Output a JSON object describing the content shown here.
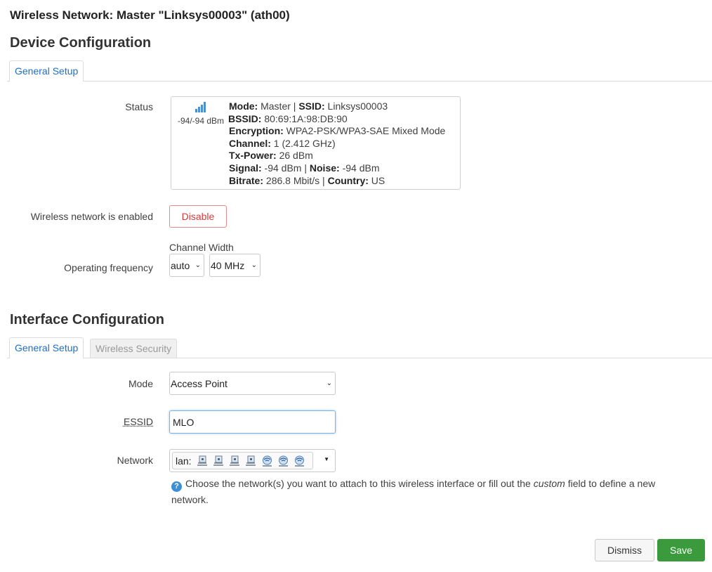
{
  "page_title": "Wireless Network: Master \"Linksys00003\" (ath00)",
  "device_config": {
    "title": "Device Configuration",
    "tabs": [
      "General Setup"
    ],
    "status_label": "Status",
    "status": {
      "signal_text": "-94/-94 dBm",
      "mode_label": "Mode:",
      "mode_value": " Master | ",
      "ssid_label": "SSID:",
      "ssid_value": " Linksys00003",
      "bssid_label": "BSSID:",
      "bssid_value": " 80:69:1A:98:DB:90",
      "encryption_label": "Encryption:",
      "encryption_value": " WPA2-PSK/WPA3-SAE Mixed Mode",
      "channel_label": "Channel:",
      "channel_value": " 1 (2.412 GHz)",
      "txpower_label": "Tx-Power:",
      "txpower_value": " 26 dBm",
      "signal_label": "Signal:",
      "signal_value": " -94 dBm | ",
      "noise_label": "Noise:",
      "noise_value": " -94 dBm",
      "bitrate_label": "Bitrate:",
      "bitrate_value": " 286.8 Mbit/s | ",
      "country_label": "Country:",
      "country_value": " US"
    },
    "enabled_label": "Wireless network is enabled",
    "disable_button": "Disable",
    "frequency_label": "Operating frequency",
    "channel_width_label": "Channel Width",
    "frequency_value": "auto",
    "channel_width_value": "40 MHz"
  },
  "interface_config": {
    "title": "Interface Configuration",
    "tabs": [
      "General Setup",
      "Wireless Security"
    ],
    "mode_label": "Mode",
    "mode_value": "Access Point",
    "essid_label": "ESSID",
    "essid_value": "MLO",
    "network_label": "Network",
    "network_prefix": "lan:",
    "network_icons": [
      "ethernet-port-icon",
      "ethernet-port-icon",
      "ethernet-port-icon",
      "ethernet-port-icon",
      "wifi-icon",
      "wifi-icon",
      "wifi-icon"
    ],
    "help_text_before": "Choose the network(s) you want to attach to this wireless interface or fill out the ",
    "help_text_em": "custom",
    "help_text_after": " field to define a new network."
  },
  "footer": {
    "dismiss_label": "Dismiss",
    "save_label": "Save"
  },
  "colors": {
    "tab_active_text": "#1f6fc0",
    "disable_text": "#d9383a",
    "save_bg": "#3b9a3c",
    "help_icon": "#3d8ed4"
  }
}
